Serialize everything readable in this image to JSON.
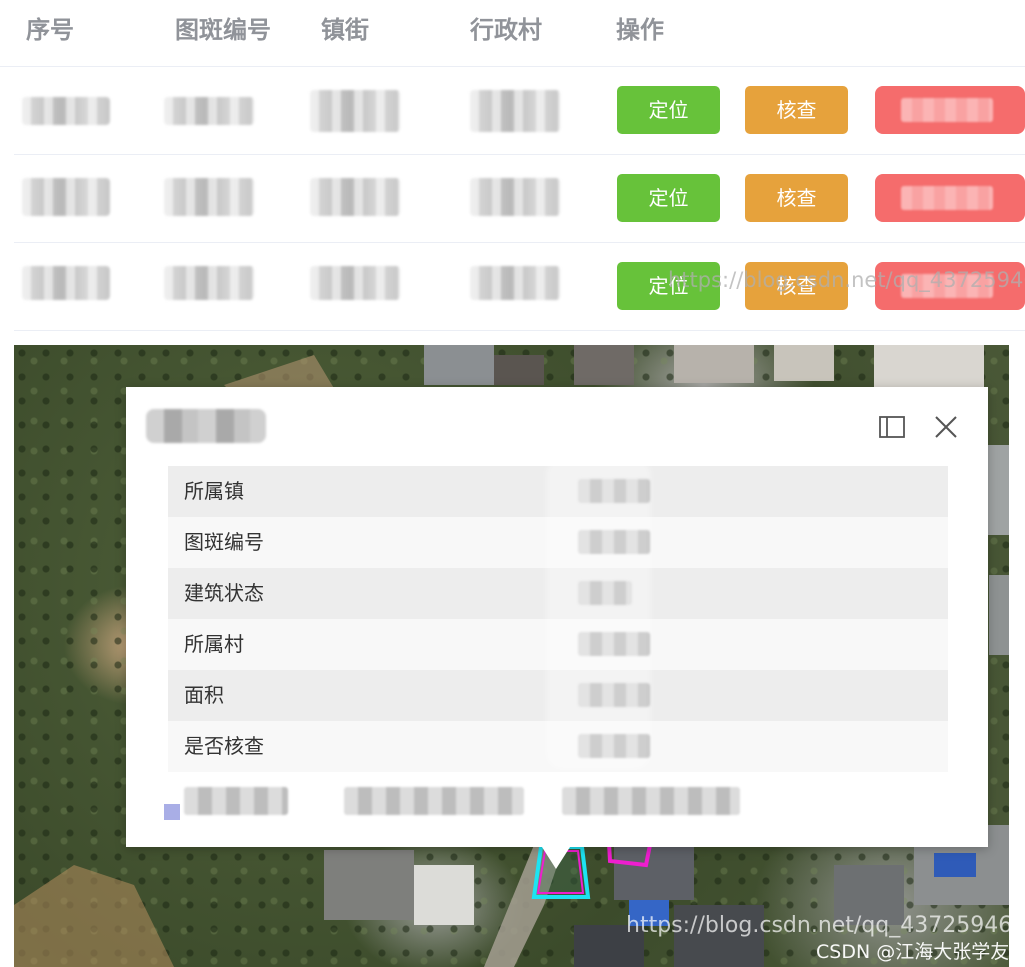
{
  "table": {
    "headers": [
      "序号",
      "图斑编号",
      "镇街",
      "行政村",
      "操作"
    ],
    "rows": [
      {
        "locate_label": "定位",
        "check_label": "核查"
      },
      {
        "locate_label": "定位",
        "check_label": "核查"
      },
      {
        "locate_label": "定位",
        "check_label": "核查"
      }
    ]
  },
  "popup": {
    "fields": [
      "所属镇",
      "图斑编号",
      "建筑状态",
      "所属村",
      "面积",
      "是否核查"
    ],
    "icons": [
      "maximize-icon",
      "close-icon"
    ],
    "close_glyph": "✕"
  },
  "watermark": {
    "row3_text": "https://blog.csdn.net/qq_43725946",
    "map_text": "https://blog.csdn.net/qq_43725946",
    "credit": "CSDN @江海大张学友"
  },
  "colors": {
    "locate_button": "#67c23a",
    "check_button": "#e6a23c",
    "delete_button": "#f56c6c",
    "parcel_cyan": "#1de3f2",
    "parcel_magenta": "#ee1ecf"
  }
}
